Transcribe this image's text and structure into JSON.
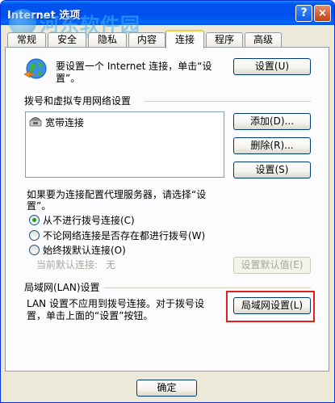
{
  "window": {
    "title": "Internet 选项",
    "help_label": "?",
    "close_label": "×"
  },
  "watermark": {
    "name": "河东软件园",
    "url": "www.pc0359.cn"
  },
  "tabs": [
    {
      "label": "常规"
    },
    {
      "label": "安全"
    },
    {
      "label": "隐私"
    },
    {
      "label": "内容"
    },
    {
      "label": "连接",
      "active": true
    },
    {
      "label": "程序"
    },
    {
      "label": "高级"
    }
  ],
  "setup": {
    "text_line1": "要设置一个 Internet 连接，单击“设",
    "text_line2": "置”。",
    "button": "设置(U)"
  },
  "dialup": {
    "heading": "拨号和虚拟专用网络设置",
    "connections": [
      "宽带连接"
    ],
    "add_button": "添加(D)...",
    "remove_button": "删除(R)...",
    "settings_button": "设置(S)",
    "proxy_text_line1": "如果要为连接配置代理服务器，请选择“设",
    "proxy_text_line2": "置”。",
    "options": [
      {
        "label": "从不进行拨号连接(C)",
        "checked": true
      },
      {
        "label": "不论网络连接是否存在都进行拨号(W)",
        "checked": false
      },
      {
        "label": "始终拨默认连接(O)",
        "checked": false
      }
    ],
    "current_default_label": "当前默认连接:",
    "current_default_value": "无",
    "set_default_button": "设置默认值(E)"
  },
  "lan": {
    "heading": "局域网(LAN)设置",
    "text_line1": "LAN 设置不应用到拨号连接。对于拨号设",
    "text_line2": "置，单击上面的“设置”按钮。",
    "button": "局域网设置(L)"
  },
  "footer": {
    "ok_button": "确定"
  },
  "colors": {
    "titlebar": "#0053ee",
    "highlight_box": "#e0211d",
    "dialog_bg": "#ece9d8"
  }
}
